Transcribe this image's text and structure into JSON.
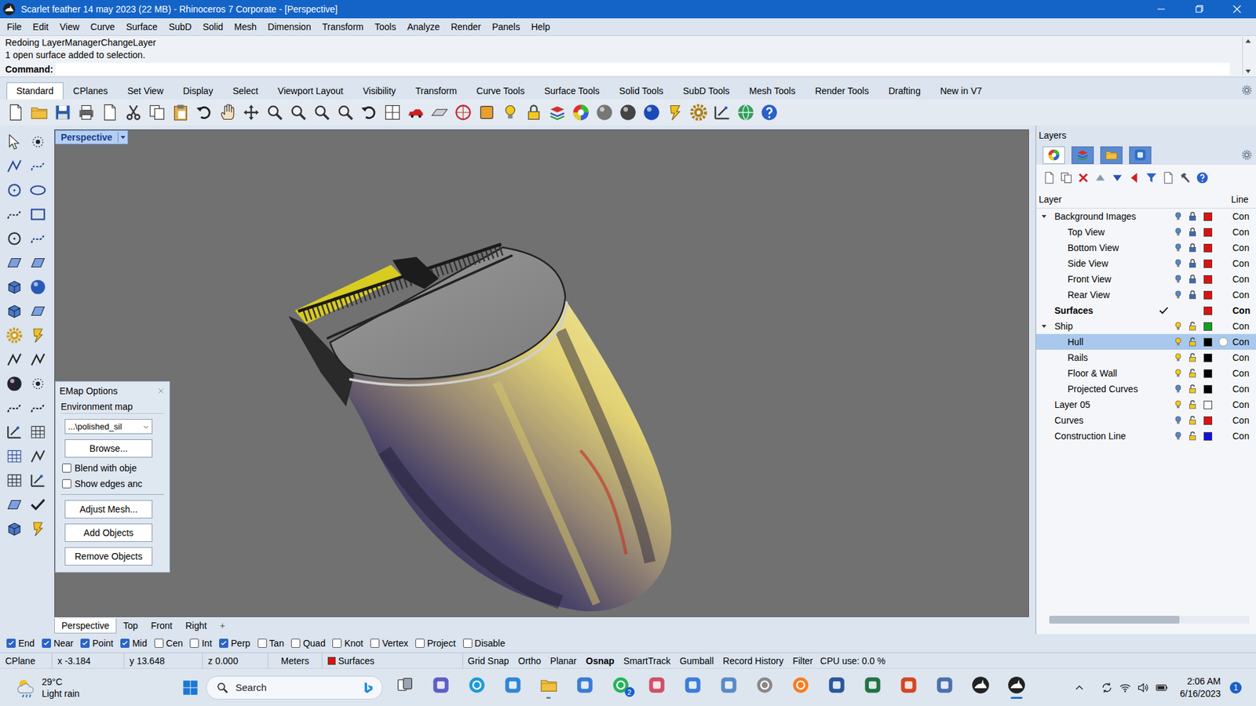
{
  "window": {
    "title": "Scarlet feather 14 may 2023 (22 MB) - Rhinoceros 7 Corporate - [Perspective]"
  },
  "menu": [
    "File",
    "Edit",
    "View",
    "Curve",
    "Surface",
    "SubD",
    "Solid",
    "Mesh",
    "Dimension",
    "Transform",
    "Tools",
    "Analyze",
    "Render",
    "Panels",
    "Help"
  ],
  "command": {
    "history": [
      "Redoing LayerManagerChangeLayer",
      "1 open surface added to selection."
    ],
    "prompt": "Command:"
  },
  "toolbar_tabs": [
    {
      "label": "Standard",
      "selected": true
    },
    {
      "label": "CPlanes",
      "selected": false
    },
    {
      "label": "Set View",
      "selected": false
    },
    {
      "label": "Display",
      "selected": false
    },
    {
      "label": "Select",
      "selected": false
    },
    {
      "label": "Viewport Layout",
      "selected": false
    },
    {
      "label": "Visibility",
      "selected": false
    },
    {
      "label": "Transform",
      "selected": false
    },
    {
      "label": "Curve Tools",
      "selected": false
    },
    {
      "label": "Surface Tools",
      "selected": false
    },
    {
      "label": "Solid Tools",
      "selected": false
    },
    {
      "label": "SubD Tools",
      "selected": false
    },
    {
      "label": "Mesh Tools",
      "selected": false
    },
    {
      "label": "Render Tools",
      "selected": false
    },
    {
      "label": "Drafting",
      "selected": false
    },
    {
      "label": "New in V7",
      "selected": false
    }
  ],
  "viewport": {
    "label": "Perspective"
  },
  "emap": {
    "title": "EMap Options",
    "section": "Environment map",
    "map": "...\\polished_sil",
    "browse": "Browse...",
    "options": [
      {
        "label": "Blend with obje",
        "checked": false
      },
      {
        "label": "Show edges anc",
        "checked": false
      }
    ],
    "buttons": [
      "Adjust Mesh...",
      "Add Objects",
      "Remove Objects"
    ]
  },
  "viewport_tabs": [
    {
      "label": "Perspective",
      "selected": true
    },
    {
      "label": "Top",
      "selected": false
    },
    {
      "label": "Front",
      "selected": false
    },
    {
      "label": "Right",
      "selected": false
    }
  ],
  "add_tab": "+",
  "osnaps": [
    {
      "label": "End",
      "checked": true
    },
    {
      "label": "Near",
      "checked": true
    },
    {
      "label": "Point",
      "checked": true
    },
    {
      "label": "Mid",
      "checked": true
    },
    {
      "label": "Cen",
      "checked": false
    },
    {
      "label": "Int",
      "checked": false
    },
    {
      "label": "Perp",
      "checked": true
    },
    {
      "label": "Tan",
      "checked": false
    },
    {
      "label": "Quad",
      "checked": false
    },
    {
      "label": "Knot",
      "checked": false
    },
    {
      "label": "Vertex",
      "checked": false
    },
    {
      "label": "Project",
      "checked": false
    },
    {
      "label": "Disable",
      "checked": false
    }
  ],
  "status_bar": {
    "cplane": "CPlane",
    "x": "x -3.184",
    "y": "y 13.648",
    "z": "z 0.000",
    "units": "Meters",
    "layer": {
      "name": "Surfaces",
      "color": "#e01010"
    },
    "toggles": [
      {
        "label": "Grid Snap",
        "on": false
      },
      {
        "label": "Ortho",
        "on": false
      },
      {
        "label": "Planar",
        "on": false
      },
      {
        "label": "Osnap",
        "on": true
      },
      {
        "label": "SmartTrack",
        "on": false
      },
      {
        "label": "Gumball",
        "on": false
      },
      {
        "label": "Record History",
        "on": false
      },
      {
        "label": "Filter",
        "on": false
      }
    ],
    "cpu": "CPU use: 0.0 %"
  },
  "layers": {
    "title": "Layers",
    "tabs": [
      {
        "selected": true
      },
      {
        "selected": false
      },
      {
        "selected": false
      },
      {
        "selected": false
      }
    ],
    "columns": [
      "Layer",
      "Line"
    ],
    "scroll_level": 0.65,
    "rows": [
      {
        "name": "Background Images",
        "depth": 0,
        "expanded": true,
        "visible": false,
        "locked": true,
        "current": false,
        "selected": false,
        "material": false,
        "color": "#e01010",
        "linetype": "Con"
      },
      {
        "name": "Top View",
        "depth": 1,
        "expanded": false,
        "visible": false,
        "locked": true,
        "current": false,
        "selected": false,
        "material": false,
        "color": "#e01010",
        "linetype": "Con"
      },
      {
        "name": "Bottom View",
        "depth": 1,
        "expanded": false,
        "visible": false,
        "locked": true,
        "current": false,
        "selected": false,
        "material": false,
        "color": "#e01010",
        "linetype": "Con"
      },
      {
        "name": "Side View",
        "depth": 1,
        "expanded": false,
        "visible": false,
        "locked": true,
        "current": false,
        "selected": false,
        "material": false,
        "color": "#e01010",
        "linetype": "Con"
      },
      {
        "name": "Front View",
        "depth": 1,
        "expanded": false,
        "visible": false,
        "locked": true,
        "current": false,
        "selected": false,
        "material": false,
        "color": "#e01010",
        "linetype": "Con"
      },
      {
        "name": "Rear View",
        "depth": 1,
        "expanded": false,
        "visible": false,
        "locked": true,
        "current": false,
        "selected": false,
        "material": false,
        "color": "#e01010",
        "linetype": "Con"
      },
      {
        "name": "Surfaces",
        "depth": 0,
        "expanded": false,
        "current": true,
        "selected": false,
        "material": false,
        "color": "#e01010",
        "linetype": "Con"
      },
      {
        "name": "Ship",
        "depth": 0,
        "expanded": true,
        "visible": true,
        "locked": false,
        "current": false,
        "selected": false,
        "material": false,
        "color": "#10a020",
        "linetype": "Con"
      },
      {
        "name": "Hull",
        "depth": 1,
        "expanded": false,
        "visible": true,
        "locked": false,
        "current": false,
        "selected": true,
        "material": true,
        "color": "#000000",
        "linetype": "Con"
      },
      {
        "name": "Rails",
        "depth": 1,
        "expanded": false,
        "visible": true,
        "locked": false,
        "current": false,
        "selected": false,
        "material": false,
        "color": "#000000",
        "linetype": "Con"
      },
      {
        "name": "Floor & Wall",
        "depth": 1,
        "expanded": false,
        "visible": true,
        "locked": false,
        "current": false,
        "selected": false,
        "material": false,
        "color": "#000000",
        "linetype": "Con"
      },
      {
        "name": "Projected Curves",
        "depth": 1,
        "expanded": false,
        "visible": false,
        "locked": false,
        "current": false,
        "selected": false,
        "material": false,
        "color": "#000000",
        "linetype": "Con"
      },
      {
        "name": "Layer 05",
        "depth": 0,
        "expanded": false,
        "visible": true,
        "locked": false,
        "current": false,
        "selected": false,
        "material": false,
        "color": "#ffffff",
        "linetype": "Con"
      },
      {
        "name": "Curves",
        "depth": 0,
        "expanded": false,
        "visible": false,
        "locked": false,
        "current": false,
        "selected": false,
        "material": false,
        "color": "#e01010",
        "linetype": "Con"
      },
      {
        "name": "Construction Line",
        "depth": 0,
        "expanded": false,
        "visible": false,
        "locked": false,
        "current": false,
        "selected": false,
        "material": false,
        "color": "#1010e0",
        "linetype": "Con"
      }
    ]
  },
  "taskbar": {
    "weather": {
      "temp": "29°C",
      "desc": "Light rain"
    },
    "search": "Search",
    "apps": [
      {
        "running": false,
        "active": false,
        "badge": ""
      },
      {
        "running": false,
        "active": false,
        "badge": ""
      },
      {
        "running": false,
        "active": false,
        "badge": ""
      },
      {
        "running": false,
        "active": false,
        "badge": ""
      },
      {
        "running": true,
        "active": false,
        "badge": ""
      },
      {
        "running": false,
        "active": false,
        "badge": ""
      },
      {
        "running": false,
        "active": false,
        "badge": "2"
      },
      {
        "running": false,
        "active": false,
        "badge": ""
      },
      {
        "running": false,
        "active": false,
        "badge": ""
      },
      {
        "running": false,
        "active": false,
        "badge": ""
      },
      {
        "running": false,
        "active": false,
        "badge": ""
      },
      {
        "running": false,
        "active": false,
        "badge": ""
      },
      {
        "running": false,
        "active": false,
        "badge": ""
      },
      {
        "running": false,
        "active": false,
        "badge": ""
      },
      {
        "running": false,
        "active": false,
        "badge": ""
      },
      {
        "running": false,
        "active": false,
        "badge": ""
      },
      {
        "running": false,
        "active": false,
        "badge": ""
      },
      {
        "running": true,
        "active": true,
        "badge": ""
      }
    ],
    "time": "2:06 AM",
    "date": "6/16/2023",
    "notifications": "1"
  }
}
